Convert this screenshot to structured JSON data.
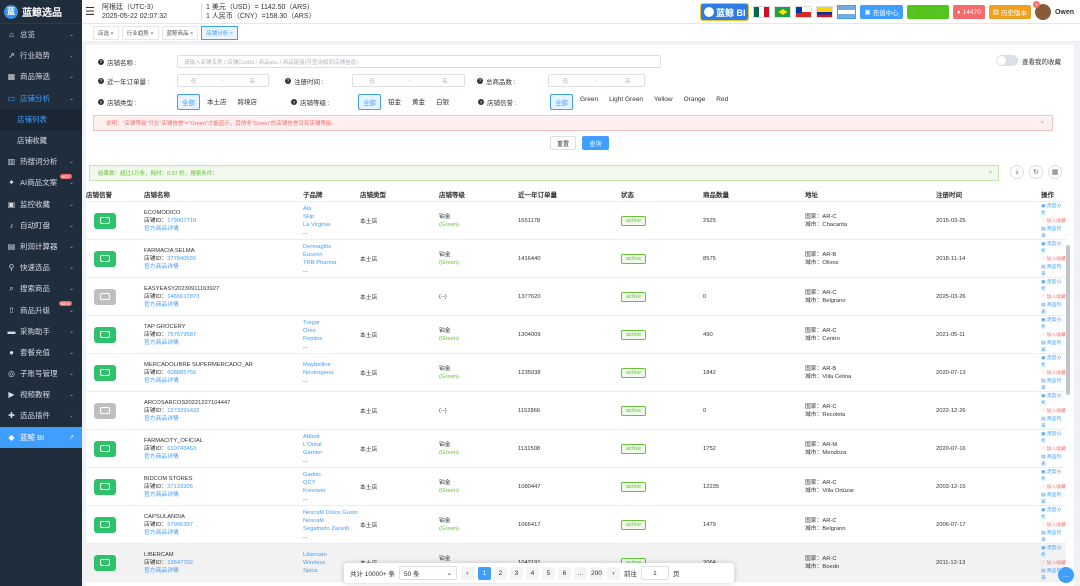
{
  "app": {
    "name": "蓝鲸选品",
    "logo_letter": "蓝"
  },
  "sidebar": {
    "items": [
      {
        "label": "总览",
        "icon": "home-icon"
      },
      {
        "label": "行业趋势",
        "icon": "trend-icon"
      },
      {
        "label": "商品筛选",
        "icon": "grid-icon"
      },
      {
        "label": "店铺分析",
        "icon": "shop-icon",
        "active": true
      },
      {
        "label": "店铺列表",
        "sub": true,
        "active": true
      },
      {
        "label": "店铺收藏",
        "sub": true
      },
      {
        "label": "热搜词分析",
        "icon": "chart-icon"
      },
      {
        "label": "AI商品文案",
        "icon": "ai-icon",
        "hot": "HOT"
      },
      {
        "label": "监控收藏",
        "icon": "monitor-icon"
      },
      {
        "label": "自动盯盘",
        "icon": "bell-icon"
      },
      {
        "label": "利润计算器",
        "icon": "calc-icon"
      },
      {
        "label": "快速选品",
        "icon": "filter-icon"
      },
      {
        "label": "搜索商品",
        "icon": "search-icon"
      },
      {
        "label": "商品升级",
        "icon": "upgrade-icon",
        "hot": "NEW"
      },
      {
        "label": "采购助手",
        "icon": "cart-icon"
      },
      {
        "label": "套餐充值",
        "icon": "user-icon"
      },
      {
        "label": "子账号管理",
        "icon": "users-icon"
      },
      {
        "label": "视频教程",
        "icon": "video-icon"
      },
      {
        "label": "选品插件",
        "icon": "plugin-icon"
      },
      {
        "label": "蓝鲸 BI",
        "icon": "bi-icon",
        "bi": true
      }
    ]
  },
  "topbar": {
    "timezone": "阿根廷（UTC-3）",
    "datetime": "2025-05-22 02:07:32",
    "rate1": "1 美元（USD）= 1142.50（ARS）",
    "rate2": "1 人民币（CNY）=158.30（ARS）",
    "bi_label": "蓝鲸 BI",
    "recharge": "充值中心",
    "promo": "大促日历",
    "points": "14470",
    "history": "历史版本",
    "user": "Owen",
    "badge": "3",
    "colors": {
      "accent": "#409eff",
      "green": "#52c41a",
      "red": "#f56c6c",
      "orange": "#f0a020"
    }
  },
  "tabs": [
    {
      "label": "店选 ×"
    },
    {
      "label": "行业趋势 ×"
    },
    {
      "label": "蓝鲸商品 ×"
    },
    {
      "label": "店铺分析 ×",
      "active": true
    }
  ],
  "filters": {
    "name_label": "店铺名称 :",
    "name_placeholder": "请输入店铺名称 / 店铺CustId / 商品sku / 商品链接(可查询相同店铺信息)",
    "fav_label": "查看我的收藏",
    "orders_label": "近一年订单量 :",
    "reg_label": "注册时间 :",
    "total_label": "总商品数 :",
    "low": "低",
    "high": "高",
    "dash": "-",
    "type_label": "店铺类型 :",
    "type_opts": [
      "全部",
      "本土店",
      "跨境店"
    ],
    "level_label": "店铺等级 :",
    "level_opts": [
      "全部",
      "铂金",
      "黄金",
      "白银"
    ],
    "rep_label": "店铺信誉 :",
    "rep_opts": [
      "全部",
      "Green",
      "Light Green",
      "Yellow",
      "Orange",
      "Red"
    ],
    "warning": "说明：\"店铺等级\"只在\"店铺信誉\"=\"Green\"才能显示，其他非\"Green\"的店铺信誉没有店铺等级。",
    "reset": "重置",
    "query": "查询",
    "result": "结果数：超过1万条，耗时：0.07 秒，搜索条件："
  },
  "table": {
    "headers": [
      "店铺信誉",
      "店铺名称",
      "子品牌",
      "店铺类型",
      "店铺等级",
      "近一年订单量",
      "状态",
      "商品数量",
      "地址",
      "注册时间",
      "操作"
    ],
    "id_prefix": "店铺ID：",
    "detail": "官方商品详情",
    "ops": [
      "走势分析",
      "加入收藏",
      "商品列表"
    ],
    "rows": [
      {
        "rep": "green",
        "name": "ECOMODICO",
        "id": "179907718",
        "brands": [
          "Ala",
          "Skip",
          "La Virginia",
          "..."
        ],
        "type": "本土店",
        "level": "铂金",
        "level_rep": "(Green)",
        "orders": "1651178",
        "status": "active",
        "count": "2925",
        "country": "国家：AR-C",
        "city": "城市：Chacarita",
        "date": "2015-03-25"
      },
      {
        "rep": "green",
        "name": "FARMACIA SELMA",
        "id": "377840555",
        "brands": [
          "Dermaglós",
          "Eucerin",
          "TRB Pharma",
          "..."
        ],
        "type": "本土店",
        "level": "铂金",
        "level_rep": "(Green)",
        "orders": "1416440",
        "status": "active",
        "count": "8575",
        "country": "国家：AR-B",
        "city": "城市：Olivos",
        "date": "2018-11-14"
      },
      {
        "rep": "gray",
        "name": "EASYEASY20230911163927",
        "id": "1465617873",
        "brands": [],
        "type": "本土店",
        "level": "(--)",
        "level_rep": "",
        "orders": "1377620",
        "status": "active",
        "count": "0",
        "country": "国家：AR-C",
        "city": "城市：Belgrano",
        "date": "2025-03-26"
      },
      {
        "rep": "green",
        "name": "TAP GROCERY",
        "id": "757579587",
        "brands": [
          "Tregar",
          "Oreo",
          "Pepitos",
          "..."
        ],
        "type": "本土店",
        "level": "铂金",
        "level_rep": "(Green)",
        "orders": "1304009",
        "status": "active",
        "count": "490",
        "country": "国家：AR-C",
        "city": "城市：Centro",
        "date": "2021-05-11"
      },
      {
        "rep": "green",
        "name": "MERCADOLIBRE SUPERMERCADO_AR",
        "id": "608885756",
        "brands": [
          "Maybelline",
          "Neutrogena",
          "..."
        ],
        "type": "本土店",
        "level": "铂金",
        "level_rep": "(Green)",
        "orders": "1235038",
        "status": "active",
        "count": "1842",
        "country": "国家：AR-B",
        "city": "城市：Villa Celina",
        "date": "2020-07-13"
      },
      {
        "rep": "gray",
        "name": "ARCOSARCOS20221227104447",
        "id": "1273291432",
        "brands": [],
        "type": "本土店",
        "level": "(--)",
        "level_rep": "",
        "orders": "1152866",
        "status": "active",
        "count": "0",
        "country": "国家：AR-C",
        "city": "城市：Recoleta",
        "date": "2022-12-26"
      },
      {
        "rep": "green",
        "name": "FARMACITY_OFICIAL",
        "id": "610743463",
        "brands": [
          "Abbott",
          "L'Oréal",
          "Garnier",
          "..."
        ],
        "type": "本土店",
        "level": "铂金",
        "level_rep": "(Green)",
        "orders": "1131508",
        "status": "active",
        "count": "1752",
        "country": "国家：AR-M",
        "city": "城市：Mendoza",
        "date": "2020-07-16"
      },
      {
        "rep": "green",
        "name": "BIDCOM STORES",
        "id": "37133205",
        "brands": [
          "Gadnic",
          "QCY",
          "Konnwei",
          "..."
        ],
        "type": "本土店",
        "level": "铂金",
        "level_rep": "(Green)",
        "orders": "1080447",
        "status": "active",
        "count": "12235",
        "country": "国家：AR-C",
        "city": "城市：Villa Ortúzar",
        "date": "2003-12-15"
      },
      {
        "rep": "green",
        "name": "CAPSULANDIA",
        "id": "57995397",
        "brands": [
          "Nescafé Dolce Gusto",
          "Nescafé",
          "Segafredo Zanetti",
          "..."
        ],
        "type": "本土店",
        "level": "铂金",
        "level_rep": "(Green)",
        "orders": "1066417",
        "status": "active",
        "count": "1479",
        "country": "国家：AR-C",
        "city": "城市：Belgrano",
        "date": "2006-07-17"
      },
      {
        "rep": "green",
        "name": "LIBERCAM",
        "id": "13647702",
        "brands": [
          "Libercam",
          "Wireless",
          "Spica"
        ],
        "type": "本土店",
        "level": "铂金",
        "level_rep": "(Green)",
        "orders": "1042191",
        "status": "active",
        "count": "2064",
        "country": "国家：AR-C",
        "city": "城市：Boedo",
        "date": "2011-12-13"
      }
    ]
  },
  "pager": {
    "total": "共计 10000+ 条",
    "size": "50 条",
    "pages": [
      "1",
      "2",
      "3",
      "4",
      "5",
      "6",
      "...",
      "200"
    ],
    "goto": "前往",
    "page_input": "1",
    "page_unit": "页"
  }
}
